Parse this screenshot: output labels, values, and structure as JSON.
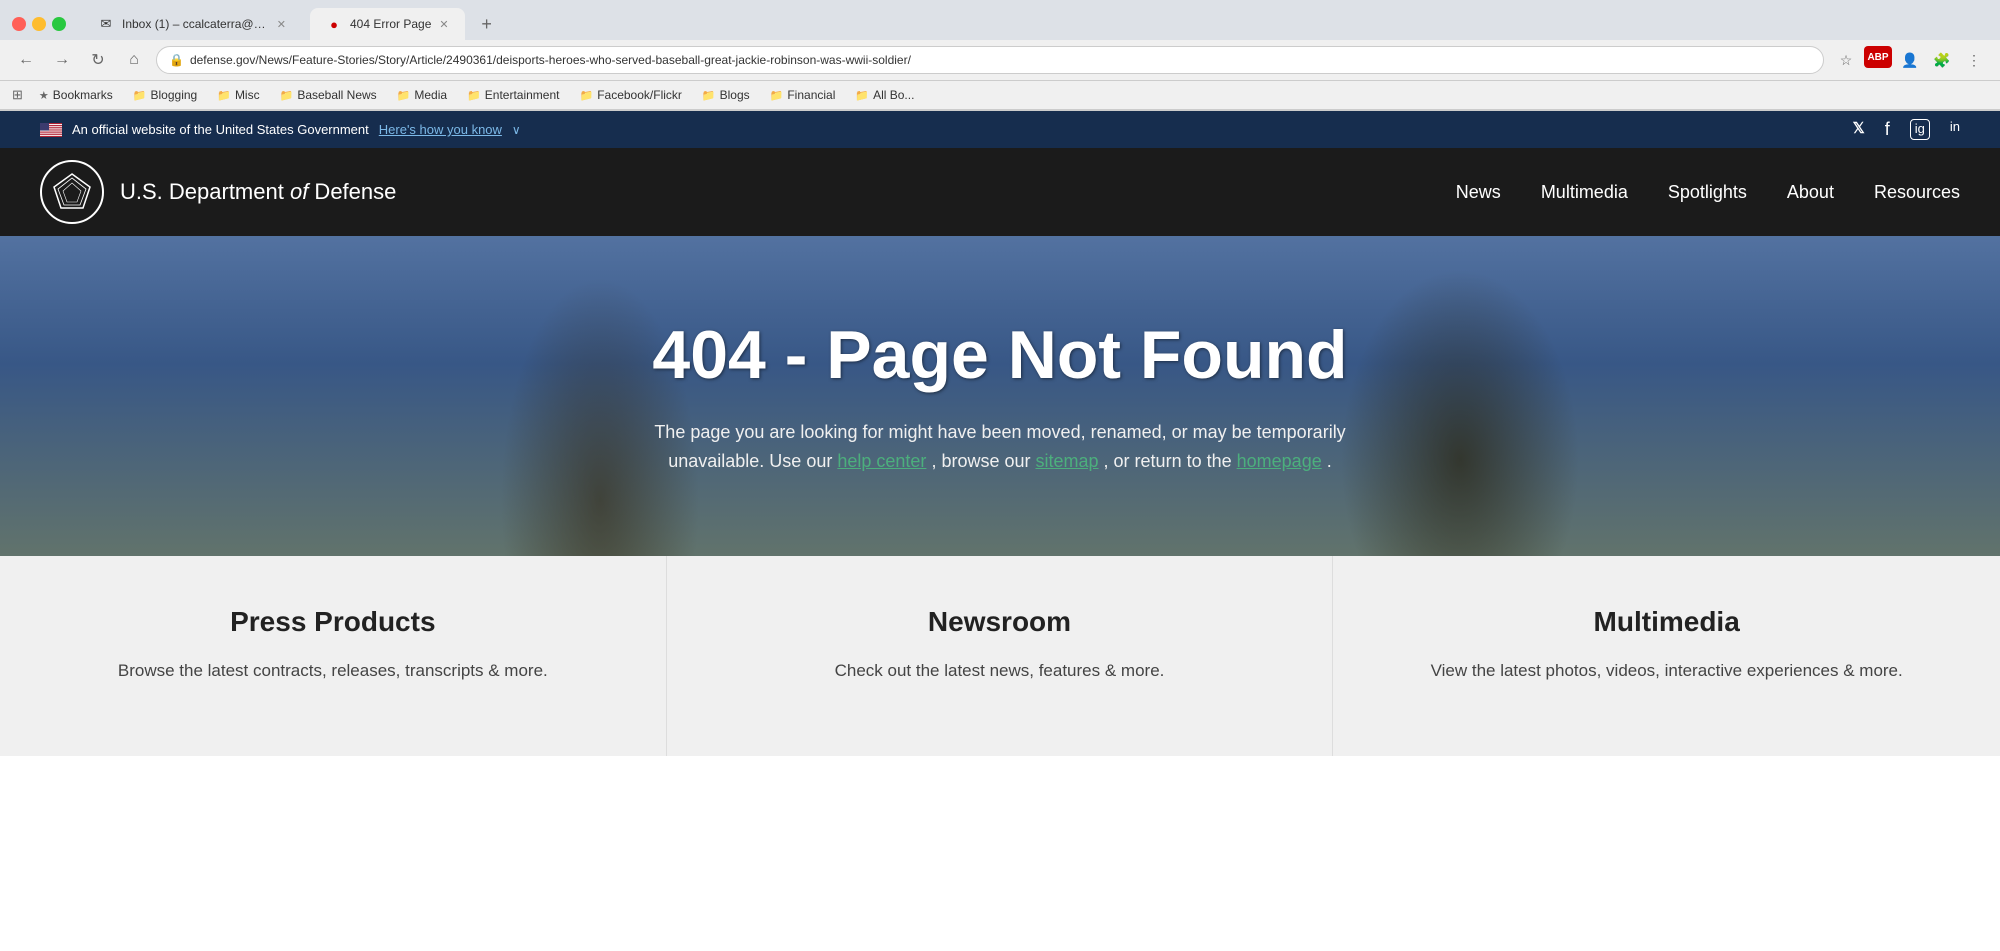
{
  "browser": {
    "tabs": [
      {
        "id": "tab1",
        "favicon": "✉",
        "title": "Inbox (1) – ccalcaterra@gmai...",
        "active": false
      },
      {
        "id": "tab2",
        "favicon": "🔴",
        "title": "404 Error Page",
        "active": true
      }
    ],
    "url": "defense.gov/News/Feature-Stories/Story/Article/2490361/deisports-heroes-who-served-baseball-great-jackie-robinson-was-wwii-soldier/",
    "nav_buttons": {
      "back": "←",
      "forward": "→",
      "refresh": "↻",
      "home": "⌂"
    }
  },
  "bookmarks": [
    {
      "id": "bm0",
      "icon": "🔖",
      "label": "Bookmarks"
    },
    {
      "id": "bm1",
      "icon": "📁",
      "label": "Blogging"
    },
    {
      "id": "bm2",
      "icon": "📁",
      "label": "Misc"
    },
    {
      "id": "bm3",
      "icon": "📁",
      "label": "Baseball News"
    },
    {
      "id": "bm4",
      "icon": "📁",
      "label": "Media"
    },
    {
      "id": "bm5",
      "icon": "📁",
      "label": "Entertainment"
    },
    {
      "id": "bm6",
      "icon": "📁",
      "label": "Facebook/Flickr"
    },
    {
      "id": "bm7",
      "icon": "📁",
      "label": "Blogs"
    },
    {
      "id": "bm8",
      "icon": "📁",
      "label": "Financial"
    },
    {
      "id": "bm9",
      "icon": "📁",
      "label": "All Bo..."
    }
  ],
  "gov_bar": {
    "official_text": "An official website of the United States Government",
    "how_to_know": "Here's how you know",
    "dropdown_icon": "∨",
    "socials": [
      "𝕏",
      "f",
      "IG",
      "in"
    ]
  },
  "site_header": {
    "logo_alt": "Pentagon Logo",
    "site_name": "U.S. Department",
    "site_name_italic": "of",
    "site_name_suffix": "Defense",
    "nav_items": [
      "News",
      "Multimedia",
      "Spotlights",
      "About",
      "Resources"
    ]
  },
  "hero": {
    "error_code": "404 - Page Not Found",
    "description_part1": "The page you are looking for might have been moved, renamed, or may be temporarily",
    "description_part2": "unavailable. Use our",
    "help_center_link": "help center",
    "description_part3": ", browse our",
    "sitemap_link": "sitemap",
    "description_part4": ", or return to the",
    "homepage_link": "homepage",
    "description_part5": "."
  },
  "cards": [
    {
      "id": "card-press",
      "title": "Press Products",
      "description": "Browse the latest contracts, releases, transcripts & more."
    },
    {
      "id": "card-newsroom",
      "title": "Newsroom",
      "description": "Check out the latest news, features & more."
    },
    {
      "id": "card-multimedia",
      "title": "Multimedia",
      "description": "View the latest photos, videos, interactive experiences & more."
    }
  ]
}
